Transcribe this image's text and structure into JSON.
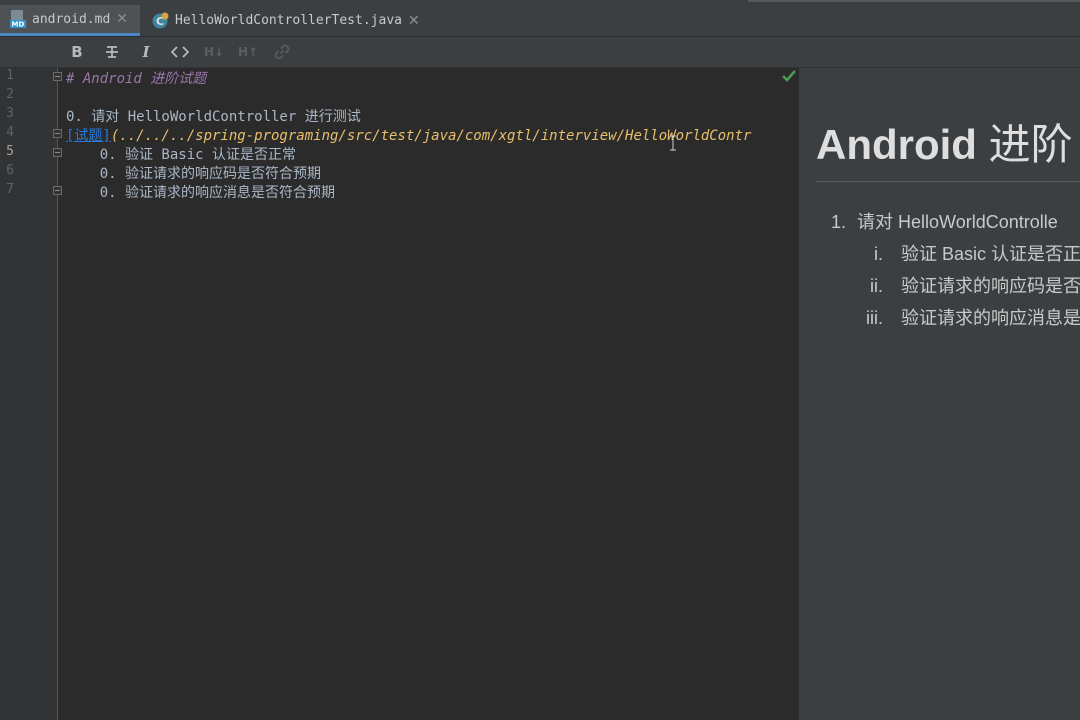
{
  "tabs": [
    {
      "label": "android.md",
      "icon": "markdown-file-icon",
      "active": true
    },
    {
      "label": "HelloWorldControllerTest.java",
      "icon": "java-class-icon",
      "active": false
    }
  ],
  "toolbar": {
    "items": [
      "bold-icon",
      "strikethrough-icon",
      "italic-icon",
      "code-icon",
      "header-down-icon",
      "header-up-icon",
      "link-icon"
    ]
  },
  "editor": {
    "line_numbers": [
      "1",
      "2",
      "3",
      "4",
      "5",
      "6",
      "7"
    ],
    "current_line": "5",
    "lines": {
      "l1": "# Android 进阶试题",
      "l3": "0. 请对 HelloWorldController 进行测试",
      "l4_link_text": "[试题]",
      "l4_link_url": "(../../../spring-programing/src/test/java/com/xgtl/interview/HelloWorldContr",
      "l5": "    0. 验证 Basic 认证是否正常",
      "l6": "    0. 验证请求的响应码是否符合预期",
      "l7": "    0. 验证请求的响应消息是否符合预期"
    },
    "status": "check-icon"
  },
  "preview": {
    "heading_latin": "Android",
    "heading_cjk": "进阶",
    "items": [
      {
        "num": "1.",
        "text": "请对 HelloWorldControlle"
      },
      {
        "num": "i.",
        "text": "验证 Basic 认证是否正"
      },
      {
        "num": "ii.",
        "text": "验证请求的响应码是否"
      },
      {
        "num": "iii.",
        "text": "验证请求的响应消息是"
      }
    ]
  },
  "colors": {
    "accent": "#4a88c7",
    "heading_markup": "#9876aa",
    "link": "#287bde",
    "url": "#e8bf6a",
    "ok": "#499c54"
  }
}
